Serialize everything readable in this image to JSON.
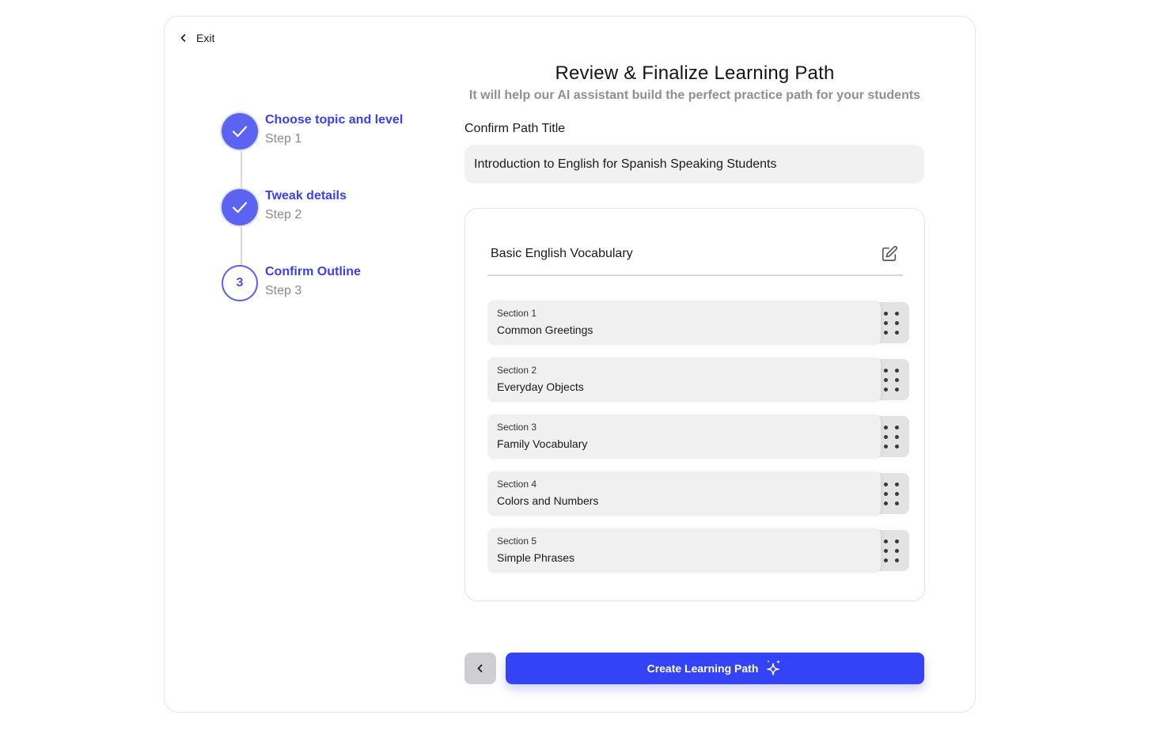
{
  "nav": {
    "exit_label": "Exit"
  },
  "stepper": {
    "steps": [
      {
        "title": "Choose topic and level",
        "subtitle": "Step 1",
        "state": "done"
      },
      {
        "title": "Tweak details",
        "subtitle": "Step 2",
        "state": "done"
      },
      {
        "title": "Confirm Outline",
        "subtitle": "Step 3",
        "state": "current",
        "number": "3"
      }
    ]
  },
  "main": {
    "heading": "Review & Finalize Learning Path",
    "subheading": "It will help our AI assistant build the perfect practice path for your students",
    "path_title_label": "Confirm Path Title",
    "path_title_value": "Introduction to English for Spanish Speaking Students"
  },
  "outline": {
    "title": "Basic English Vocabulary",
    "edit_icon": "pencil-square-icon",
    "sections": [
      {
        "label": "Section 1",
        "name": "Common Greetings"
      },
      {
        "label": "Section 2",
        "name": "Everyday Objects"
      },
      {
        "label": "Section 3",
        "name": "Family Vocabulary"
      },
      {
        "label": "Section 4",
        "name": "Colors and Numbers"
      },
      {
        "label": "Section 5",
        "name": "Simple Phrases"
      }
    ]
  },
  "actions": {
    "back_icon": "chevron-left-icon",
    "create_label": "Create Learning Path",
    "create_icon": "sparkle-icon"
  },
  "colors": {
    "accent": "#3443f5",
    "step_done": "#5b63f0",
    "step_text": "#3a3ff0",
    "muted": "#8b8f97"
  }
}
